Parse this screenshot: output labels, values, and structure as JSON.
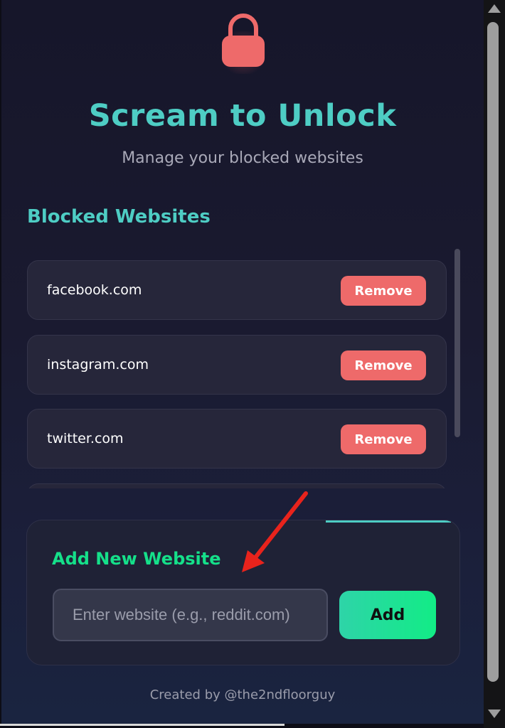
{
  "header": {
    "lock_icon": "padlock-icon",
    "lock_color": "#ee6a6a",
    "title": "Scream to Unlock",
    "subtitle": "Manage your blocked websites"
  },
  "blocked": {
    "section_title": "Blocked Websites",
    "items": [
      {
        "site": "facebook.com",
        "action_label": "Remove"
      },
      {
        "site": "instagram.com",
        "action_label": "Remove"
      },
      {
        "site": "twitter.com",
        "action_label": "Remove"
      }
    ]
  },
  "add_section": {
    "title": "Add New Website",
    "input_placeholder": "Enter website (e.g., reddit.com)",
    "input_value": "",
    "add_label": "Add"
  },
  "footer": {
    "credit": "Created by @the2ndfloorguy"
  },
  "colors": {
    "accent_teal": "#4ecdc4",
    "remove_red": "#ee6a6a",
    "add_green": "#15e08a",
    "annotation_arrow": "#e8231c"
  },
  "annotation": {
    "arrow_icon": "red-arrow-icon"
  }
}
